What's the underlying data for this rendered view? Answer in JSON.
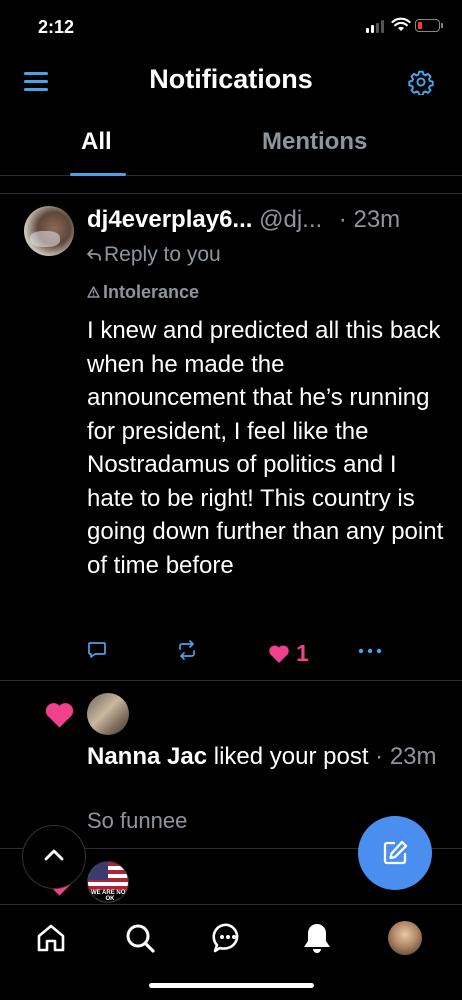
{
  "status_bar": {
    "time": "2:12"
  },
  "header": {
    "title": "Notifications"
  },
  "tabs": [
    {
      "label": "All"
    },
    {
      "label": "Mentions"
    }
  ],
  "post": {
    "author_name": "dj4everplay6...",
    "author_handle": "@dj...",
    "time": "· 23m",
    "reply_label": "Reply to you",
    "label_tag": "Intolerance",
    "text": "I knew and predicted all this back when he made the announcement that he’s running for president, I feel like the Nostradamus of politics and I hate to be right! This country is going down further than any point of time before",
    "like_count": "1",
    "accent_like": "#f0428c"
  },
  "like_notification": {
    "user": "Nanna Jac",
    "action": "liked your post",
    "time": "· 23m",
    "snippet": "So funnee"
  },
  "next_notification": {
    "avatar_text": "WE ARE NOT OK"
  },
  "icons": {
    "menu": "menu-icon",
    "settings": "gear-icon",
    "reply": "reply-icon",
    "label": "warning-icon",
    "comment": "comment-icon",
    "repost": "repost-icon",
    "like": "heart-icon",
    "more": "more-icon",
    "scroll_top": "chevron-up-icon",
    "compose": "compose-icon",
    "home": "home-icon",
    "search": "search-icon",
    "chat": "chat-icon",
    "notifications": "bell-icon"
  },
  "colors": {
    "accent": "#4aa3e8",
    "like": "#f0428c",
    "compose": "#4a8ff0",
    "muted": "#8e969c"
  }
}
